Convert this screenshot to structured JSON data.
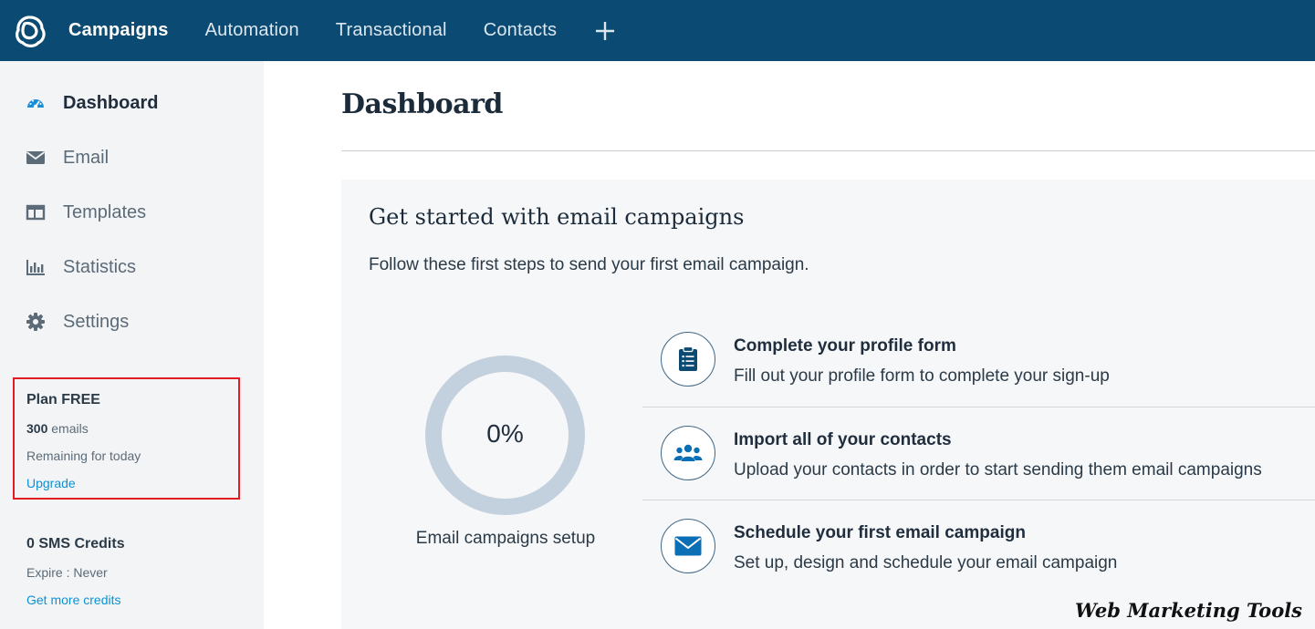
{
  "topnav": {
    "logo_icon": "sendinblue-logo-icon",
    "items": [
      {
        "label": "Campaigns",
        "active": true
      },
      {
        "label": "Automation",
        "active": false
      },
      {
        "label": "Transactional",
        "active": false
      },
      {
        "label": "Contacts",
        "active": false
      }
    ],
    "add_label": "+"
  },
  "sidebar": {
    "items": [
      {
        "label": "Dashboard",
        "icon": "gauge-icon",
        "active": true
      },
      {
        "label": "Email",
        "icon": "envelope-icon",
        "active": false
      },
      {
        "label": "Templates",
        "icon": "layout-icon",
        "active": false
      },
      {
        "label": "Statistics",
        "icon": "bar-chart-icon",
        "active": false
      },
      {
        "label": "Settings",
        "icon": "gear-icon",
        "active": false
      }
    ],
    "plan": {
      "title": "Plan FREE",
      "emails_count": "300",
      "emails_unit": " emails",
      "remaining": "Remaining for today",
      "upgrade": "Upgrade"
    },
    "sms": {
      "title": "0 SMS Credits",
      "expire": "Expire : Never",
      "more": "Get more credits"
    }
  },
  "main": {
    "title": "Dashboard",
    "card": {
      "title": "Get started with email campaigns",
      "subtitle": "Follow these first steps to send your first email campaign.",
      "progress_fraction": 0,
      "progress_text": "0%",
      "progress_label": "Email campaigns setup",
      "steps": [
        {
          "title": "Complete your profile form",
          "desc": "Fill out your profile form to complete your sign-up",
          "icon": "clipboard-icon"
        },
        {
          "title": "Import all of your contacts",
          "desc": "Upload your contacts in order to start sending them email campaigns",
          "icon": "users-icon"
        },
        {
          "title": "Schedule your first email campaign",
          "desc": "Set up, design and schedule your email campaign",
          "icon": "envelope-icon"
        }
      ]
    }
  },
  "watermark": "Web Marketing Tools",
  "colors": {
    "topbar": "#0b4a72",
    "link": "#0b92d3",
    "highlight_border": "#e31b23",
    "progress_ring": "#c3d0dd"
  }
}
